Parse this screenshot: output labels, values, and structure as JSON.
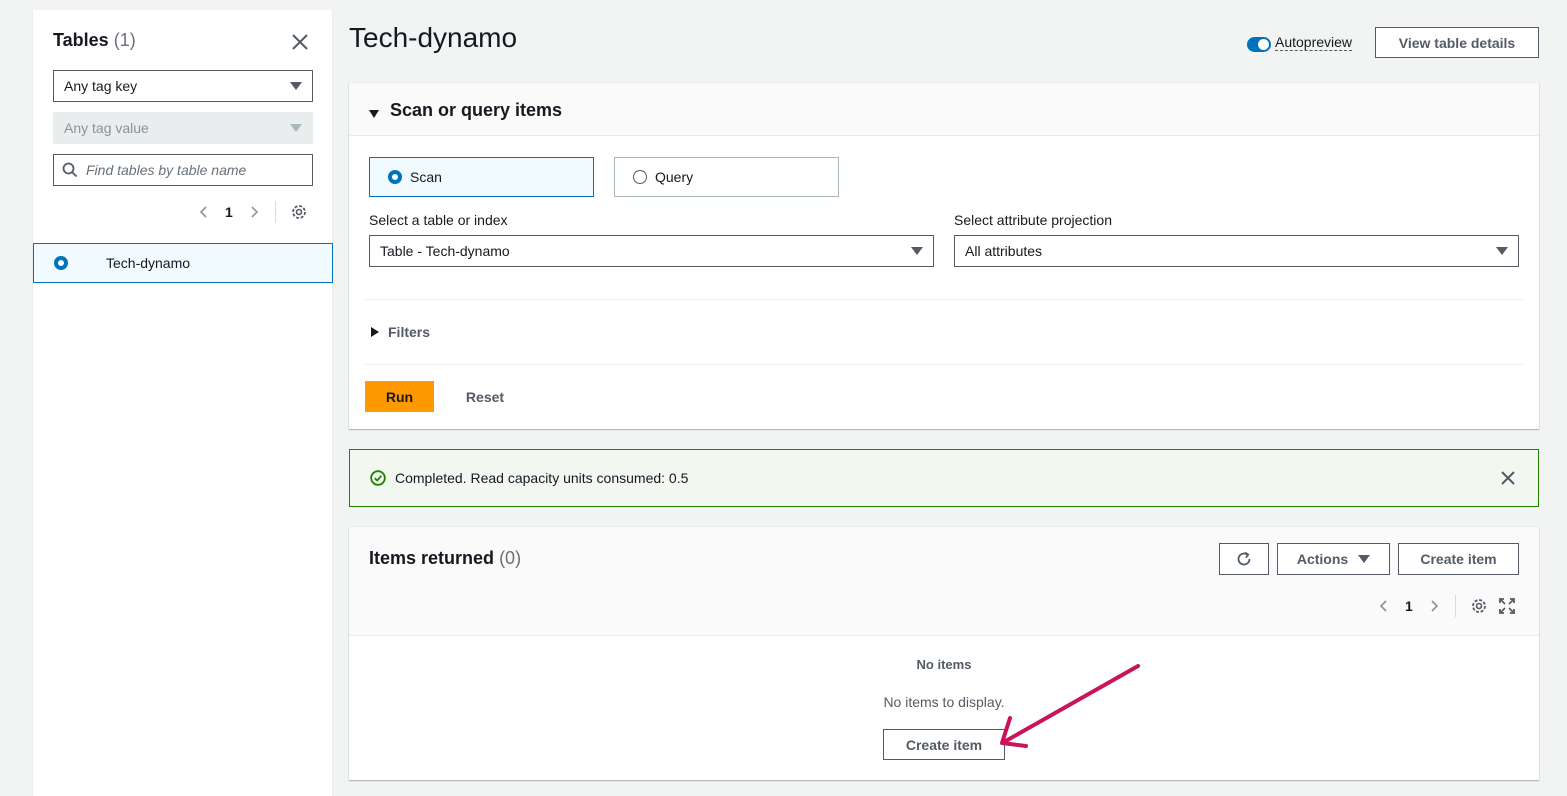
{
  "sidebar": {
    "title": "Tables",
    "count": "(1)",
    "tag_key_select": "Any tag key",
    "tag_value_select": "Any tag value",
    "search_placeholder": "Find tables by table name",
    "page_number": "1",
    "tables": [
      {
        "name": "Tech-dynamo",
        "selected": true
      }
    ]
  },
  "header": {
    "title": "Tech-dynamo",
    "autopreview_label": "Autopreview",
    "autopreview_on": true,
    "view_details_label": "View table details"
  },
  "scan_panel": {
    "title": "Scan or query items",
    "modes": [
      {
        "label": "Scan",
        "selected": true
      },
      {
        "label": "Query",
        "selected": false
      }
    ],
    "table_select_label": "Select a table or index",
    "table_select_value": "Table - Tech-dynamo",
    "projection_label": "Select attribute projection",
    "projection_value": "All attributes",
    "filters_label": "Filters",
    "run_label": "Run",
    "reset_label": "Reset"
  },
  "flash": {
    "message": "Completed. Read capacity units consumed: 0.5",
    "status_color": "#1d8102"
  },
  "items_panel": {
    "title": "Items returned",
    "count": "(0)",
    "actions_label": "Actions",
    "create_item_label": "Create item",
    "page_number": "1",
    "empty_title": "No items",
    "empty_message": "No items to display.",
    "empty_create_label": "Create item"
  },
  "colors": {
    "accent": "#0073bb",
    "run_button": "#ff9900",
    "annotation_arrow": "#c7145a"
  }
}
